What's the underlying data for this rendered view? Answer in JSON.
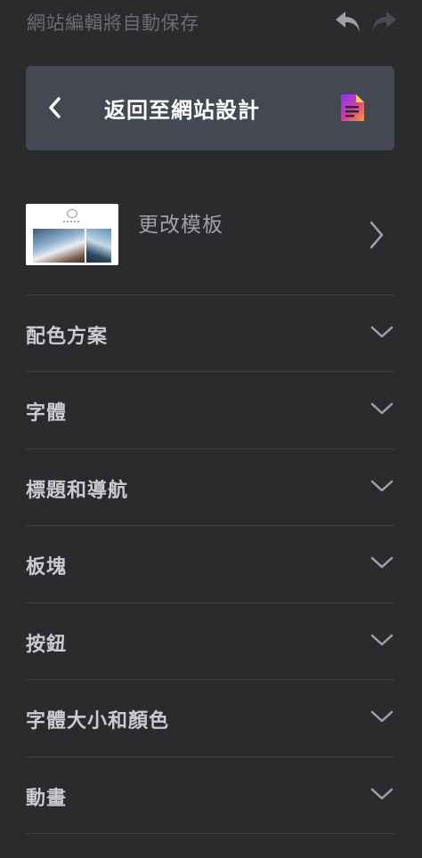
{
  "header": {
    "autosave_text": "網站編輯將自動保存"
  },
  "back_card": {
    "label": "返回至網站設計"
  },
  "template": {
    "label": "更改模板"
  },
  "sections": [
    {
      "label": "配色方案"
    },
    {
      "label": "字體"
    },
    {
      "label": "標題和導航"
    },
    {
      "label": "板塊"
    },
    {
      "label": "按鈕"
    },
    {
      "label": "字體大小和顏色"
    },
    {
      "label": "動畫"
    }
  ],
  "icons": {
    "undo": "undo-icon",
    "redo": "redo-icon",
    "back": "chevron-left-icon",
    "document": "document-icon",
    "template_arrow": "chevron-right-icon",
    "expand": "chevron-down-icon"
  },
  "colors": {
    "background": "#2b2b2e",
    "card": "#444852",
    "text": "#c9cbd1",
    "muted": "#6b6d74",
    "divider": "#3d3f44"
  }
}
